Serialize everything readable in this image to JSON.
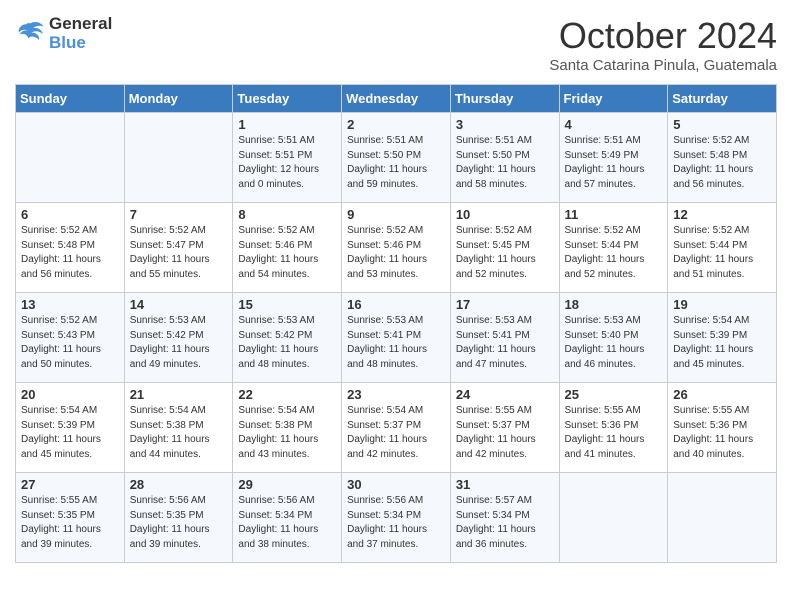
{
  "logo": {
    "line1": "General",
    "line2": "Blue"
  },
  "title": "October 2024",
  "subtitle": "Santa Catarina Pinula, Guatemala",
  "days_of_week": [
    "Sunday",
    "Monday",
    "Tuesday",
    "Wednesday",
    "Thursday",
    "Friday",
    "Saturday"
  ],
  "weeks": [
    [
      {
        "day": "",
        "info": ""
      },
      {
        "day": "",
        "info": ""
      },
      {
        "day": "1",
        "sunrise": "5:51 AM",
        "sunset": "5:51 PM",
        "daylight": "12 hours and 0 minutes."
      },
      {
        "day": "2",
        "sunrise": "5:51 AM",
        "sunset": "5:50 PM",
        "daylight": "11 hours and 59 minutes."
      },
      {
        "day": "3",
        "sunrise": "5:51 AM",
        "sunset": "5:50 PM",
        "daylight": "11 hours and 58 minutes."
      },
      {
        "day": "4",
        "sunrise": "5:51 AM",
        "sunset": "5:49 PM",
        "daylight": "11 hours and 57 minutes."
      },
      {
        "day": "5",
        "sunrise": "5:52 AM",
        "sunset": "5:48 PM",
        "daylight": "11 hours and 56 minutes."
      }
    ],
    [
      {
        "day": "6",
        "sunrise": "5:52 AM",
        "sunset": "5:48 PM",
        "daylight": "11 hours and 56 minutes."
      },
      {
        "day": "7",
        "sunrise": "5:52 AM",
        "sunset": "5:47 PM",
        "daylight": "11 hours and 55 minutes."
      },
      {
        "day": "8",
        "sunrise": "5:52 AM",
        "sunset": "5:46 PM",
        "daylight": "11 hours and 54 minutes."
      },
      {
        "day": "9",
        "sunrise": "5:52 AM",
        "sunset": "5:46 PM",
        "daylight": "11 hours and 53 minutes."
      },
      {
        "day": "10",
        "sunrise": "5:52 AM",
        "sunset": "5:45 PM",
        "daylight": "11 hours and 52 minutes."
      },
      {
        "day": "11",
        "sunrise": "5:52 AM",
        "sunset": "5:44 PM",
        "daylight": "11 hours and 52 minutes."
      },
      {
        "day": "12",
        "sunrise": "5:52 AM",
        "sunset": "5:44 PM",
        "daylight": "11 hours and 51 minutes."
      }
    ],
    [
      {
        "day": "13",
        "sunrise": "5:52 AM",
        "sunset": "5:43 PM",
        "daylight": "11 hours and 50 minutes."
      },
      {
        "day": "14",
        "sunrise": "5:53 AM",
        "sunset": "5:42 PM",
        "daylight": "11 hours and 49 minutes."
      },
      {
        "day": "15",
        "sunrise": "5:53 AM",
        "sunset": "5:42 PM",
        "daylight": "11 hours and 48 minutes."
      },
      {
        "day": "16",
        "sunrise": "5:53 AM",
        "sunset": "5:41 PM",
        "daylight": "11 hours and 48 minutes."
      },
      {
        "day": "17",
        "sunrise": "5:53 AM",
        "sunset": "5:41 PM",
        "daylight": "11 hours and 47 minutes."
      },
      {
        "day": "18",
        "sunrise": "5:53 AM",
        "sunset": "5:40 PM",
        "daylight": "11 hours and 46 minutes."
      },
      {
        "day": "19",
        "sunrise": "5:54 AM",
        "sunset": "5:39 PM",
        "daylight": "11 hours and 45 minutes."
      }
    ],
    [
      {
        "day": "20",
        "sunrise": "5:54 AM",
        "sunset": "5:39 PM",
        "daylight": "11 hours and 45 minutes."
      },
      {
        "day": "21",
        "sunrise": "5:54 AM",
        "sunset": "5:38 PM",
        "daylight": "11 hours and 44 minutes."
      },
      {
        "day": "22",
        "sunrise": "5:54 AM",
        "sunset": "5:38 PM",
        "daylight": "11 hours and 43 minutes."
      },
      {
        "day": "23",
        "sunrise": "5:54 AM",
        "sunset": "5:37 PM",
        "daylight": "11 hours and 42 minutes."
      },
      {
        "day": "24",
        "sunrise": "5:55 AM",
        "sunset": "5:37 PM",
        "daylight": "11 hours and 42 minutes."
      },
      {
        "day": "25",
        "sunrise": "5:55 AM",
        "sunset": "5:36 PM",
        "daylight": "11 hours and 41 minutes."
      },
      {
        "day": "26",
        "sunrise": "5:55 AM",
        "sunset": "5:36 PM",
        "daylight": "11 hours and 40 minutes."
      }
    ],
    [
      {
        "day": "27",
        "sunrise": "5:55 AM",
        "sunset": "5:35 PM",
        "daylight": "11 hours and 39 minutes."
      },
      {
        "day": "28",
        "sunrise": "5:56 AM",
        "sunset": "5:35 PM",
        "daylight": "11 hours and 39 minutes."
      },
      {
        "day": "29",
        "sunrise": "5:56 AM",
        "sunset": "5:34 PM",
        "daylight": "11 hours and 38 minutes."
      },
      {
        "day": "30",
        "sunrise": "5:56 AM",
        "sunset": "5:34 PM",
        "daylight": "11 hours and 37 minutes."
      },
      {
        "day": "31",
        "sunrise": "5:57 AM",
        "sunset": "5:34 PM",
        "daylight": "11 hours and 36 minutes."
      },
      {
        "day": "",
        "info": ""
      },
      {
        "day": "",
        "info": ""
      }
    ]
  ],
  "labels": {
    "sunrise": "Sunrise:",
    "sunset": "Sunset:",
    "daylight": "Daylight:"
  }
}
